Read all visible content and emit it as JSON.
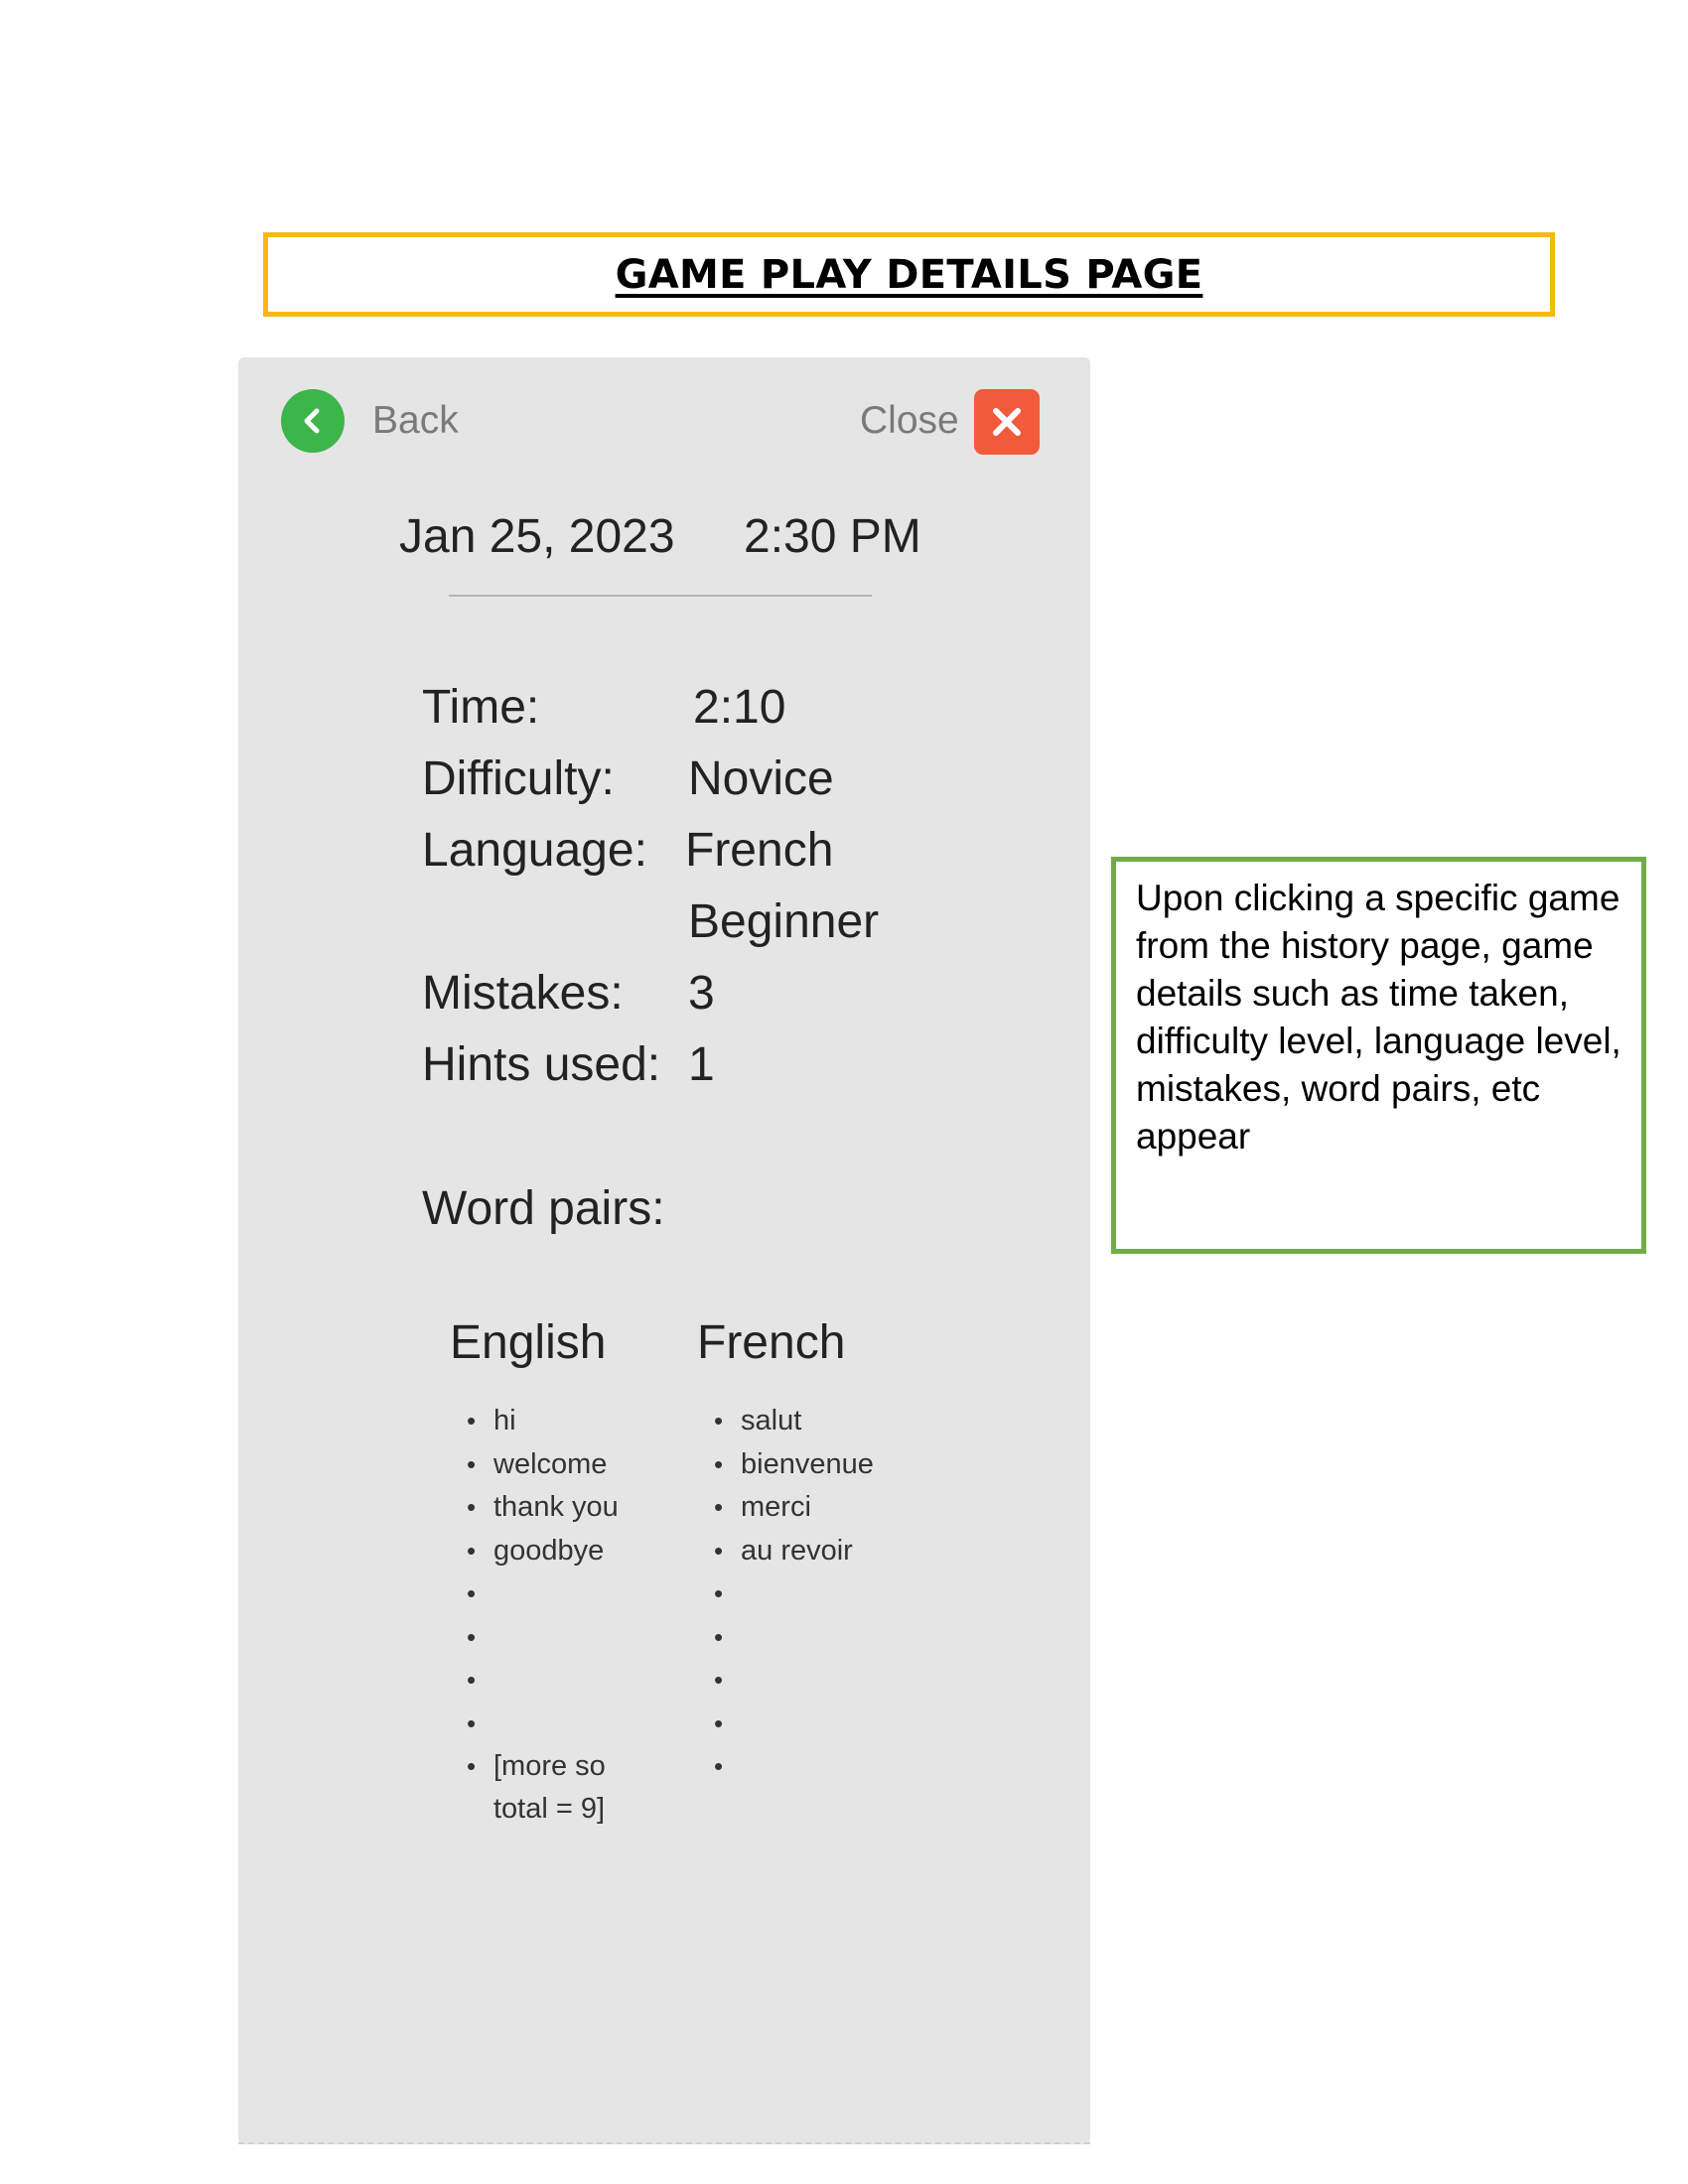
{
  "page_title": "GAME PLAY DETAILS PAGE",
  "header": {
    "back_label": "Back",
    "close_label": "Close"
  },
  "session": {
    "date": "Jan 25, 2023",
    "time": "2:30 PM"
  },
  "stats": [
    {
      "label": "Time:",
      "value": "2:10"
    },
    {
      "label": "Difficulty:",
      "value": "Novice"
    },
    {
      "label": "Language:",
      "value": "French"
    },
    {
      "label": "",
      "value": "Beginner"
    },
    {
      "label": "Mistakes:",
      "value": "3"
    },
    {
      "label": "Hints used:",
      "value": "1"
    }
  ],
  "word_pairs": {
    "label": "Word pairs:",
    "english_header": "English",
    "french_header": "French",
    "english": [
      "hi",
      "welcome",
      "thank you",
      "goodbye",
      "",
      "",
      "",
      "",
      "[more so total = 9]"
    ],
    "french": [
      "salut",
      "bienvenue",
      "merci",
      "au revoir",
      "",
      "",
      "",
      "",
      ""
    ]
  },
  "annotation": {
    "text": "Upon clicking a specific game from the history page, game details such as time taken, difficulty level, language level, mistakes, word pairs, etc appear"
  },
  "colors": {
    "title_border": "#f5b915",
    "note_border": "#70ad47",
    "back_icon": "#3cb54a",
    "close_icon": "#f25a3c",
    "panel_bg": "#e5e5e5"
  },
  "icons": {
    "back": "chevron-left-icon",
    "close": "close-icon"
  }
}
